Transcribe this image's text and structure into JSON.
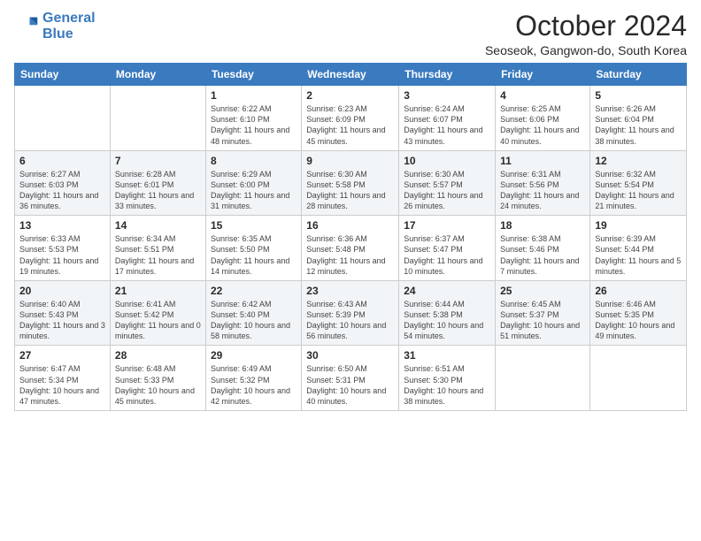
{
  "logo": {
    "line1": "General",
    "line2": "Blue"
  },
  "title": "October 2024",
  "location": "Seoseok, Gangwon-do, South Korea",
  "weekdays": [
    "Sunday",
    "Monday",
    "Tuesday",
    "Wednesday",
    "Thursday",
    "Friday",
    "Saturday"
  ],
  "weeks": [
    [
      {
        "day": "",
        "info": ""
      },
      {
        "day": "",
        "info": ""
      },
      {
        "day": "1",
        "info": "Sunrise: 6:22 AM\nSunset: 6:10 PM\nDaylight: 11 hours and 48 minutes."
      },
      {
        "day": "2",
        "info": "Sunrise: 6:23 AM\nSunset: 6:09 PM\nDaylight: 11 hours and 45 minutes."
      },
      {
        "day": "3",
        "info": "Sunrise: 6:24 AM\nSunset: 6:07 PM\nDaylight: 11 hours and 43 minutes."
      },
      {
        "day": "4",
        "info": "Sunrise: 6:25 AM\nSunset: 6:06 PM\nDaylight: 11 hours and 40 minutes."
      },
      {
        "day": "5",
        "info": "Sunrise: 6:26 AM\nSunset: 6:04 PM\nDaylight: 11 hours and 38 minutes."
      }
    ],
    [
      {
        "day": "6",
        "info": "Sunrise: 6:27 AM\nSunset: 6:03 PM\nDaylight: 11 hours and 36 minutes."
      },
      {
        "day": "7",
        "info": "Sunrise: 6:28 AM\nSunset: 6:01 PM\nDaylight: 11 hours and 33 minutes."
      },
      {
        "day": "8",
        "info": "Sunrise: 6:29 AM\nSunset: 6:00 PM\nDaylight: 11 hours and 31 minutes."
      },
      {
        "day": "9",
        "info": "Sunrise: 6:30 AM\nSunset: 5:58 PM\nDaylight: 11 hours and 28 minutes."
      },
      {
        "day": "10",
        "info": "Sunrise: 6:30 AM\nSunset: 5:57 PM\nDaylight: 11 hours and 26 minutes."
      },
      {
        "day": "11",
        "info": "Sunrise: 6:31 AM\nSunset: 5:56 PM\nDaylight: 11 hours and 24 minutes."
      },
      {
        "day": "12",
        "info": "Sunrise: 6:32 AM\nSunset: 5:54 PM\nDaylight: 11 hours and 21 minutes."
      }
    ],
    [
      {
        "day": "13",
        "info": "Sunrise: 6:33 AM\nSunset: 5:53 PM\nDaylight: 11 hours and 19 minutes."
      },
      {
        "day": "14",
        "info": "Sunrise: 6:34 AM\nSunset: 5:51 PM\nDaylight: 11 hours and 17 minutes."
      },
      {
        "day": "15",
        "info": "Sunrise: 6:35 AM\nSunset: 5:50 PM\nDaylight: 11 hours and 14 minutes."
      },
      {
        "day": "16",
        "info": "Sunrise: 6:36 AM\nSunset: 5:48 PM\nDaylight: 11 hours and 12 minutes."
      },
      {
        "day": "17",
        "info": "Sunrise: 6:37 AM\nSunset: 5:47 PM\nDaylight: 11 hours and 10 minutes."
      },
      {
        "day": "18",
        "info": "Sunrise: 6:38 AM\nSunset: 5:46 PM\nDaylight: 11 hours and 7 minutes."
      },
      {
        "day": "19",
        "info": "Sunrise: 6:39 AM\nSunset: 5:44 PM\nDaylight: 11 hours and 5 minutes."
      }
    ],
    [
      {
        "day": "20",
        "info": "Sunrise: 6:40 AM\nSunset: 5:43 PM\nDaylight: 11 hours and 3 minutes."
      },
      {
        "day": "21",
        "info": "Sunrise: 6:41 AM\nSunset: 5:42 PM\nDaylight: 11 hours and 0 minutes."
      },
      {
        "day": "22",
        "info": "Sunrise: 6:42 AM\nSunset: 5:40 PM\nDaylight: 10 hours and 58 minutes."
      },
      {
        "day": "23",
        "info": "Sunrise: 6:43 AM\nSunset: 5:39 PM\nDaylight: 10 hours and 56 minutes."
      },
      {
        "day": "24",
        "info": "Sunrise: 6:44 AM\nSunset: 5:38 PM\nDaylight: 10 hours and 54 minutes."
      },
      {
        "day": "25",
        "info": "Sunrise: 6:45 AM\nSunset: 5:37 PM\nDaylight: 10 hours and 51 minutes."
      },
      {
        "day": "26",
        "info": "Sunrise: 6:46 AM\nSunset: 5:35 PM\nDaylight: 10 hours and 49 minutes."
      }
    ],
    [
      {
        "day": "27",
        "info": "Sunrise: 6:47 AM\nSunset: 5:34 PM\nDaylight: 10 hours and 47 minutes."
      },
      {
        "day": "28",
        "info": "Sunrise: 6:48 AM\nSunset: 5:33 PM\nDaylight: 10 hours and 45 minutes."
      },
      {
        "day": "29",
        "info": "Sunrise: 6:49 AM\nSunset: 5:32 PM\nDaylight: 10 hours and 42 minutes."
      },
      {
        "day": "30",
        "info": "Sunrise: 6:50 AM\nSunset: 5:31 PM\nDaylight: 10 hours and 40 minutes."
      },
      {
        "day": "31",
        "info": "Sunrise: 6:51 AM\nSunset: 5:30 PM\nDaylight: 10 hours and 38 minutes."
      },
      {
        "day": "",
        "info": ""
      },
      {
        "day": "",
        "info": ""
      }
    ]
  ]
}
